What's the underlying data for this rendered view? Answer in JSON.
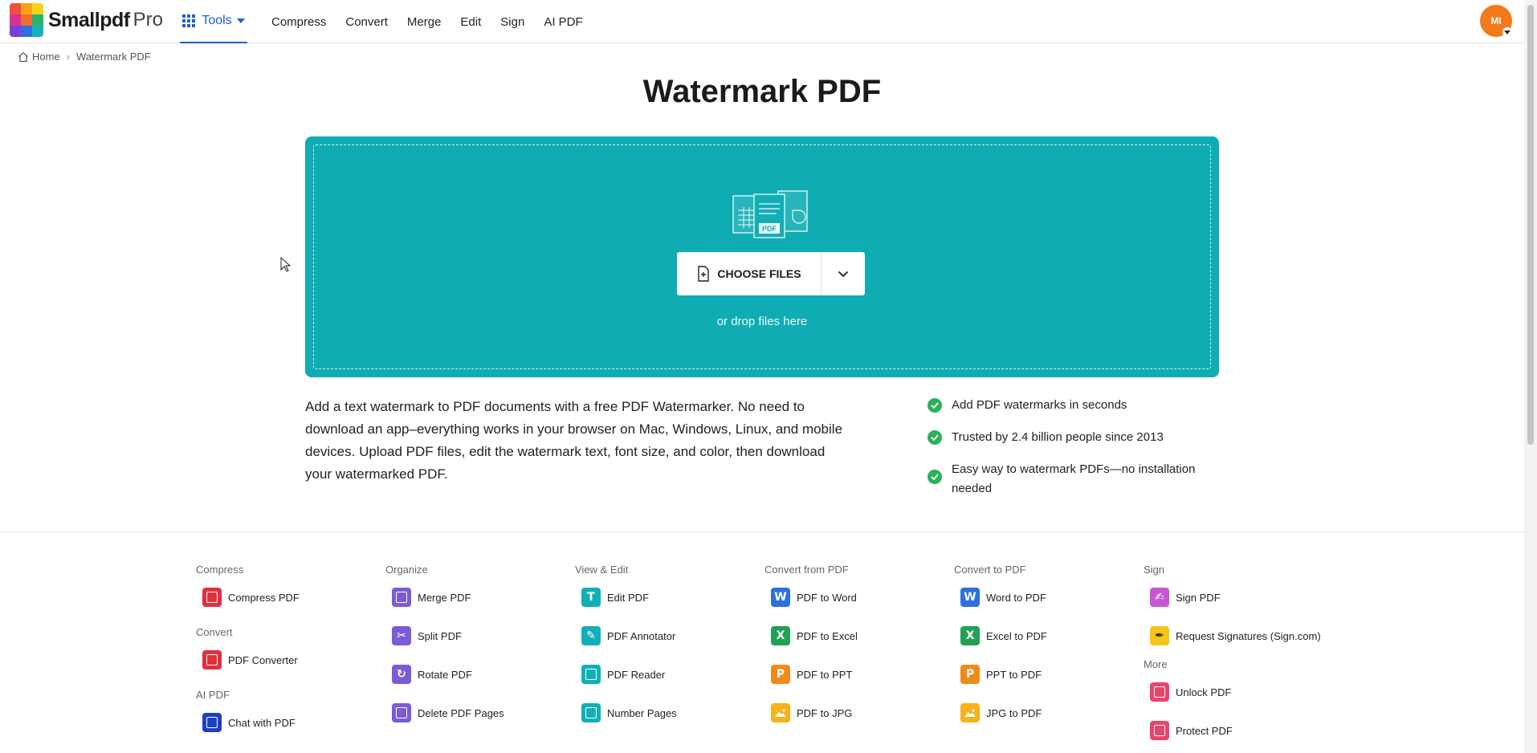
{
  "header": {
    "logo_text": "Smallpdf",
    "logo_pro": "Pro",
    "tools_label": "Tools",
    "nav": [
      "Compress",
      "Convert",
      "Merge",
      "Edit",
      "Sign",
      "AI PDF"
    ],
    "avatar_initials": "MI",
    "avatar_color": "#f27a1a"
  },
  "breadcrumb": {
    "home": "Home",
    "sep": "›",
    "current": "Watermark PDF"
  },
  "page": {
    "title": "Watermark PDF"
  },
  "dropzone": {
    "color": "#10acb3",
    "choose_label": "CHOOSE FILES",
    "hint": "or drop files here",
    "illustration_label": "PDF"
  },
  "description": "Add a text watermark to PDF documents with a free PDF Watermarker. No need to download an app–everything works in your browser on Mac, Windows, Linux, and mobile devices. Upload PDF files, edit the watermark text, font size, and color, then download your watermarked PDF.",
  "features": [
    "Add PDF watermarks in seconds",
    "Trusted by 2.4 billion people since 2013",
    "Easy way to watermark PDFs—no installation needed"
  ],
  "tools": {
    "compress": {
      "heading": "Compress",
      "items": [
        {
          "label": "Compress PDF",
          "icon": "compress-icon",
          "color": "#e0303e"
        }
      ]
    },
    "convert": {
      "heading": "Convert",
      "items": [
        {
          "label": "PDF Converter",
          "icon": "converter-icon",
          "color": "#e0303e"
        }
      ]
    },
    "ai": {
      "heading": "AI PDF",
      "items": [
        {
          "label": "Chat with PDF",
          "icon": "chat-ai-icon",
          "color": "#1d3fc4"
        }
      ]
    },
    "organize": {
      "heading": "Organize",
      "items": [
        {
          "label": "Merge PDF",
          "icon": "merge-icon",
          "color": "#7b5bd6"
        },
        {
          "label": "Split PDF",
          "icon": "scissors-icon",
          "color": "#7b5bd6"
        },
        {
          "label": "Rotate PDF",
          "icon": "rotate-icon",
          "color": "#7b5bd6"
        },
        {
          "label": "Delete PDF Pages",
          "icon": "trash-icon",
          "color": "#7b5bd6"
        }
      ]
    },
    "view_edit": {
      "heading": "View & Edit",
      "items": [
        {
          "label": "Edit PDF",
          "icon": "text-edit-icon",
          "color": "#12b0b6"
        },
        {
          "label": "PDF Annotator",
          "icon": "pen-icon",
          "color": "#12b0b6"
        },
        {
          "label": "PDF Reader",
          "icon": "reader-icon",
          "color": "#12b0b6"
        },
        {
          "label": "Number Pages",
          "icon": "number-icon",
          "color": "#12b0b6"
        }
      ]
    },
    "convert_from": {
      "heading": "Convert from PDF",
      "items": [
        {
          "label": "PDF to Word",
          "icon": "word-icon",
          "color": "#2f6fe0",
          "glyph": "W"
        },
        {
          "label": "PDF to Excel",
          "icon": "excel-icon",
          "color": "#20a153",
          "glyph": "X"
        },
        {
          "label": "PDF to PPT",
          "icon": "ppt-icon",
          "color": "#f08a1c",
          "glyph": "P"
        },
        {
          "label": "PDF to JPG",
          "icon": "image-icon",
          "color": "#f5b21c"
        }
      ]
    },
    "convert_to": {
      "heading": "Convert to PDF",
      "items": [
        {
          "label": "Word to PDF",
          "icon": "word-icon",
          "color": "#2f6fe0",
          "glyph": "W"
        },
        {
          "label": "Excel to PDF",
          "icon": "excel-icon",
          "color": "#20a153",
          "glyph": "X"
        },
        {
          "label": "PPT to PDF",
          "icon": "ppt-icon",
          "color": "#f08a1c",
          "glyph": "P"
        },
        {
          "label": "JPG to PDF",
          "icon": "image-icon",
          "color": "#f5b21c"
        }
      ]
    },
    "sign": {
      "heading": "Sign",
      "items": [
        {
          "label": "Sign PDF",
          "icon": "signature-icon",
          "color": "#c755d6"
        },
        {
          "label": "Request Signatures (Sign.com)",
          "icon": "pen-nib-icon",
          "color": "#f5c518"
        }
      ]
    },
    "more": {
      "heading": "More",
      "items": [
        {
          "label": "Unlock PDF",
          "icon": "unlock-icon",
          "color": "#e8456a"
        },
        {
          "label": "Protect PDF",
          "icon": "lock-icon",
          "color": "#e8456a"
        }
      ]
    }
  }
}
